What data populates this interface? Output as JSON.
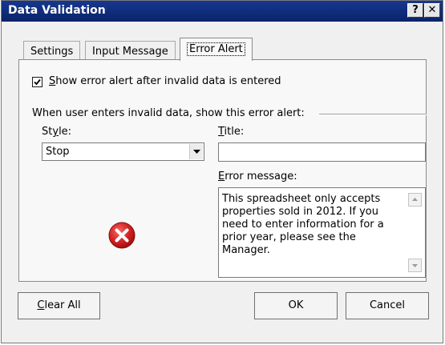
{
  "window": {
    "title": "Data Validation",
    "help_label": "?",
    "close_label": "✕"
  },
  "tabs": [
    {
      "label": "Settings",
      "active": false
    },
    {
      "label": "Input Message",
      "active": false
    },
    {
      "label": "Error Alert",
      "active": true
    }
  ],
  "error_alert": {
    "show_checkbox": {
      "label_accel": "S",
      "label_rest": "how error alert after invalid data is entered",
      "checked": true
    },
    "section_label": "When user enters invalid data, show this error alert:",
    "style": {
      "label_pre": "St",
      "label_accel": "y",
      "label_post": "le:",
      "selected": "Stop"
    },
    "title": {
      "label_accel": "T",
      "label_rest": "itle:",
      "value": ""
    },
    "error_message": {
      "label_accel": "E",
      "label_rest": "rror message:",
      "value": "This spreadsheet only accepts properties sold in 2012. If you need to enter information for a prior year, please see the Manager."
    },
    "style_icon": "error-stop-icon"
  },
  "buttons": {
    "clear_all_accel": "C",
    "clear_all_rest": "lear All",
    "ok": "OK",
    "cancel": "Cancel"
  },
  "colors": {
    "titlebar": "#0a246a",
    "error_red": "#d42424"
  }
}
